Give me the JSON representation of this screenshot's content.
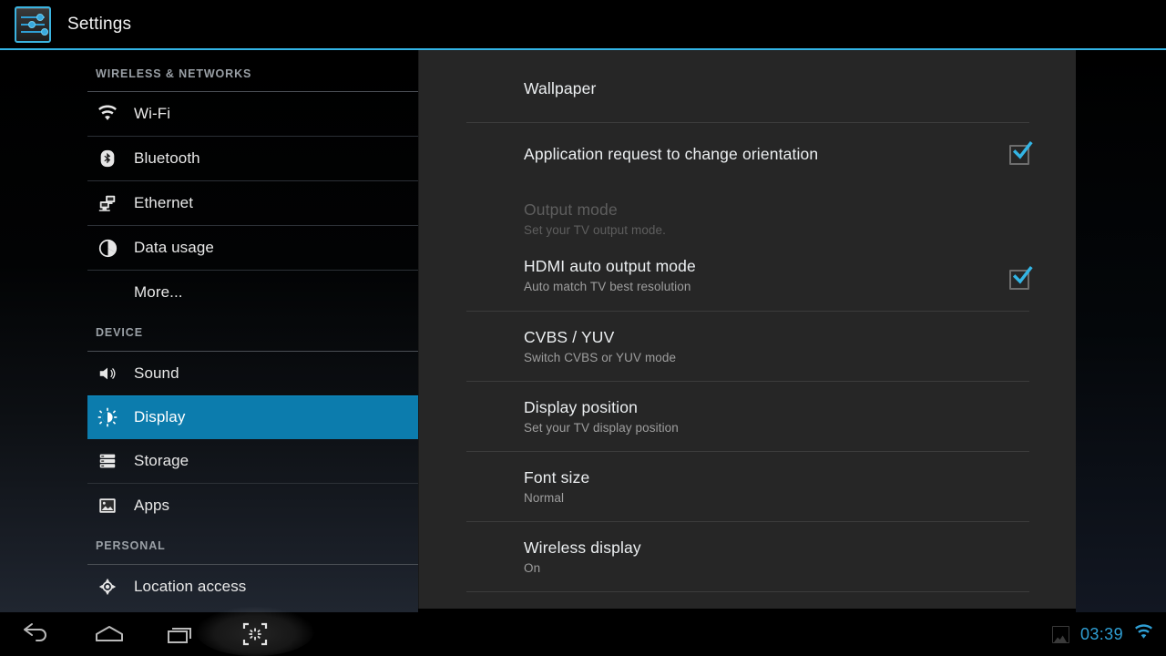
{
  "header": {
    "title": "Settings",
    "icon": "settings-sliders-icon",
    "accent_color": "#33b5e5"
  },
  "sidebar": {
    "sections": [
      {
        "label": "WIRELESS & NETWORKS",
        "items": [
          {
            "label": "Wi-Fi",
            "icon": "wifi-icon",
            "selected": false
          },
          {
            "label": "Bluetooth",
            "icon": "bluetooth-icon",
            "selected": false
          },
          {
            "label": "Ethernet",
            "icon": "ethernet-icon",
            "selected": false
          },
          {
            "label": "Data usage",
            "icon": "data-usage-icon",
            "selected": false
          },
          {
            "label": "More...",
            "icon": null,
            "selected": false
          }
        ]
      },
      {
        "label": "DEVICE",
        "items": [
          {
            "label": "Sound",
            "icon": "sound-icon",
            "selected": false
          },
          {
            "label": "Display",
            "icon": "display-brightness-icon",
            "selected": true
          },
          {
            "label": "Storage",
            "icon": "storage-icon",
            "selected": false
          },
          {
            "label": "Apps",
            "icon": "apps-image-icon",
            "selected": false
          }
        ]
      },
      {
        "label": "PERSONAL",
        "items": [
          {
            "label": "Location access",
            "icon": "location-icon",
            "selected": false
          }
        ]
      }
    ],
    "selected_color": "#0c7cad"
  },
  "main": {
    "rows": [
      {
        "title": "Wallpaper",
        "sub": null,
        "checkbox": null,
        "disabled": false
      },
      {
        "title": "Application request to change orientation",
        "sub": null,
        "checkbox": true,
        "disabled": false
      },
      {
        "title": "Output mode",
        "sub": "Set your TV output mode.",
        "checkbox": null,
        "disabled": true
      },
      {
        "title": "HDMI auto output mode",
        "sub": "Auto match TV best resolution",
        "checkbox": true,
        "disabled": false
      },
      {
        "title": "CVBS / YUV",
        "sub": "Switch CVBS or YUV mode",
        "checkbox": null,
        "disabled": false
      },
      {
        "title": "Display position",
        "sub": "Set your TV display position",
        "checkbox": null,
        "disabled": false
      },
      {
        "title": "Font size",
        "sub": "Normal",
        "checkbox": null,
        "disabled": false
      },
      {
        "title": "Wireless display",
        "sub": "On",
        "checkbox": null,
        "disabled": false
      }
    ],
    "checkbox_color": "#33b5e5"
  },
  "navbar": {
    "buttons": [
      {
        "name": "back-icon"
      },
      {
        "name": "home-icon"
      },
      {
        "name": "recent-apps-icon"
      },
      {
        "name": "screenshot-icon"
      }
    ],
    "status": {
      "screenshot_notification_icon": "image-notification-icon",
      "clock": "03:39",
      "wifi_icon": "wifi-icon",
      "clock_color": "#2f9fd4"
    }
  }
}
